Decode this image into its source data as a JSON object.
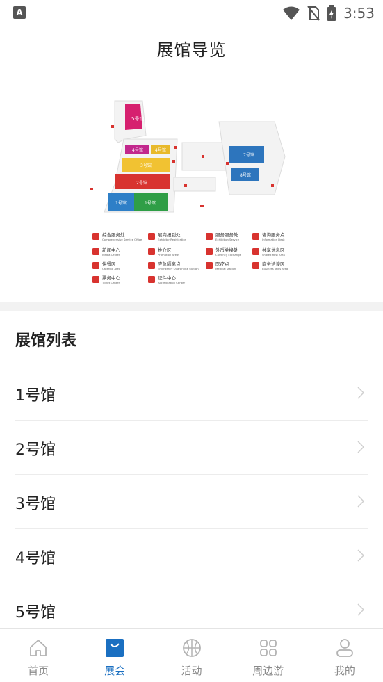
{
  "status_bar": {
    "left_badge": "A",
    "time": "3:53"
  },
  "header": {
    "title": "展馆导览"
  },
  "map": {
    "halls": [
      {
        "label": "5号馆",
        "color": "#d6206f"
      },
      {
        "label": "4号馆",
        "color": "#c2288d"
      },
      {
        "label": "4号馆",
        "color": "#e8b92b"
      },
      {
        "label": "3号馆",
        "color": "#f1c232"
      },
      {
        "label": "2号馆",
        "color": "#d8332f"
      },
      {
        "label": "1号馆",
        "color": "#2e7fc7"
      },
      {
        "label": "1号馆",
        "color": "#2f9e46"
      },
      {
        "label": "7号馆",
        "color": "#2d75bd"
      },
      {
        "label": "8号馆",
        "color": "#2d75bd"
      }
    ],
    "legend": [
      {
        "cn": "综合服务处",
        "en": "Comprehensive Service Office"
      },
      {
        "cn": "展商报到处",
        "en": "Exhibitor Registration"
      },
      {
        "cn": "服务服务处",
        "en": "Exhibition Service"
      },
      {
        "cn": "咨询服务点",
        "en": "Information Desk"
      },
      {
        "cn": "新闻中心",
        "en": "Media Center"
      },
      {
        "cn": "推介区",
        "en": "Promotion Areas"
      },
      {
        "cn": "外币兑换处",
        "en": "Currency Exchange"
      },
      {
        "cn": "共享休息区",
        "en": "Shared Rest Area"
      },
      {
        "cn": "供餐区",
        "en": "Catering Area"
      },
      {
        "cn": "应急隔离点",
        "en": "Emergency Quarantine Station"
      },
      {
        "cn": "医疗点",
        "en": "Medical Station"
      },
      {
        "cn": "商务洽谈区",
        "en": "Business Talks Area"
      },
      {
        "cn": "票务中心",
        "en": "Ticket Center"
      },
      {
        "cn": "证件中心",
        "en": "Accreditation Center"
      }
    ],
    "accent_red": "#d8332f"
  },
  "list": {
    "title": "展馆列表",
    "items": [
      {
        "label": "1号馆"
      },
      {
        "label": "2号馆"
      },
      {
        "label": "3号馆"
      },
      {
        "label": "4号馆"
      },
      {
        "label": "5号馆"
      }
    ]
  },
  "bottom_nav": {
    "items": [
      {
        "label": "首页",
        "icon": "home-icon"
      },
      {
        "label": "展会",
        "icon": "bag-icon"
      },
      {
        "label": "活动",
        "icon": "basketball-icon"
      },
      {
        "label": "周边游",
        "icon": "grid-icon"
      },
      {
        "label": "我的",
        "icon": "user-icon"
      }
    ],
    "active_index": 1,
    "active_color": "#1a6fc1"
  }
}
